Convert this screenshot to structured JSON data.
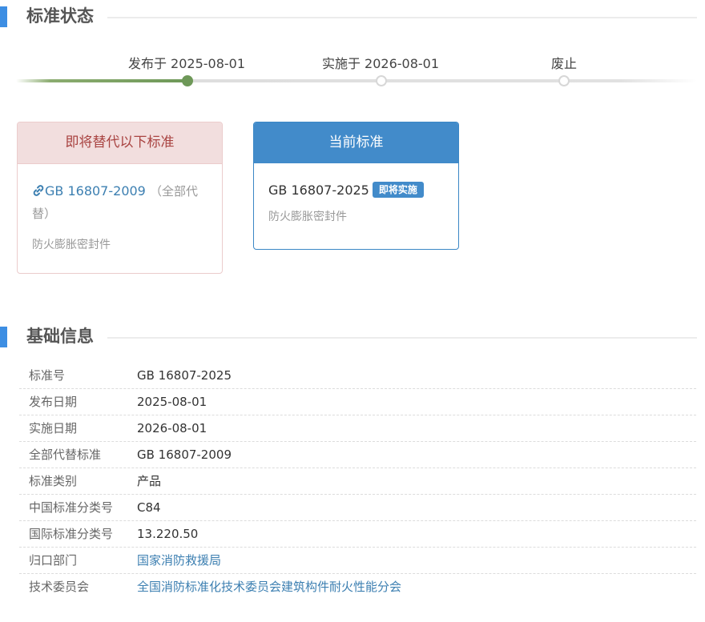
{
  "status_section": {
    "title": "标准状态"
  },
  "timeline": {
    "published": "发布于 2025-08-01",
    "implemented": "实施于 2026-08-01",
    "abolished": "废止"
  },
  "replace_card": {
    "header": "即将替代以下标准",
    "code": "GB 16807-2009",
    "note": "（全部代替）",
    "desc": "防火膨胀密封件"
  },
  "current_card": {
    "header": "当前标准",
    "code": "GB 16807-2025",
    "badge": "即将实施",
    "desc": "防火膨胀密封件"
  },
  "info_section": {
    "title": "基础信息"
  },
  "info": [
    {
      "label": "标准号",
      "value": "GB 16807-2025"
    },
    {
      "label": "发布日期",
      "value": "2025-08-01"
    },
    {
      "label": "实施日期",
      "value": "2026-08-01"
    },
    {
      "label": "全部代替标准",
      "value": "GB 16807-2009"
    },
    {
      "label": "标准类别",
      "value": "产品"
    },
    {
      "label": "中国标准分类号",
      "value": "C84"
    },
    {
      "label": "国际标准分类号",
      "value": "13.220.50"
    },
    {
      "label": "归口部门",
      "value": "国家消防救援局"
    },
    {
      "label": "技术委员会",
      "value": "全国消防标准化技术委员会建筑构件耐火性能分会"
    }
  ],
  "colors": {
    "accent": "#428bca",
    "done": "#6e9858",
    "danger_bg": "#f2dede",
    "danger_text": "#a94442"
  }
}
